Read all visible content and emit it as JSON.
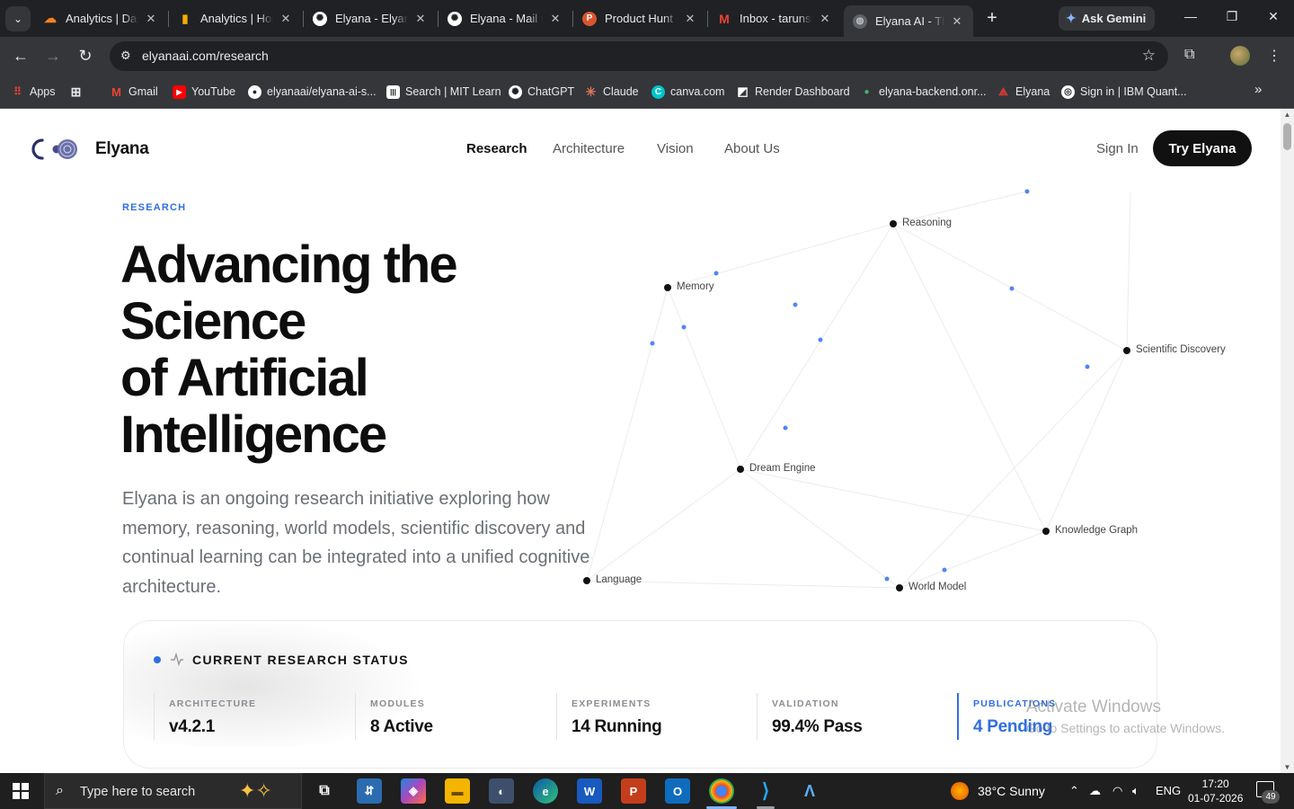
{
  "browser": {
    "tabs": [
      {
        "label": "Analytics | Dashboard",
        "fav_color": "#f6821f",
        "fav_glyph": "☁"
      },
      {
        "label": "Analytics | Home",
        "fav_color": "#f9ab00",
        "fav_glyph": "▮"
      },
      {
        "label": "Elyana - Elyana",
        "fav_color": "#ffffff",
        "fav_glyph": "✺"
      },
      {
        "label": "Elyana - Mail to",
        "fav_color": "#ffffff",
        "fav_glyph": "✺"
      },
      {
        "label": "Product Hunt –",
        "fav_color": "#da552f",
        "fav_glyph": "P"
      },
      {
        "label": "Inbox - tarunsi",
        "fav_color": "#ea4335",
        "fav_glyph": "M"
      },
      {
        "label": "Elyana AI - The",
        "fav_color": "#9aa0a6",
        "fav_glyph": "◍"
      }
    ],
    "new_tab": "+",
    "gemini_label": "Ask Gemini",
    "url": "elyanaai.com/research",
    "bookmarks": [
      {
        "label": "Apps",
        "color": "#4285f4",
        "glyph": "⋮⋮"
      },
      {
        "label": "",
        "color": "#5f6368",
        "glyph": "⊞"
      },
      {
        "label": "Gmail",
        "color": "#ea4335",
        "glyph": "M"
      },
      {
        "label": "YouTube",
        "color": "#ff0000",
        "glyph": "▶"
      },
      {
        "label": "elyanaai/elyana-ai-s...",
        "color": "#ffffff",
        "glyph": "●"
      },
      {
        "label": "Search | MIT Learn",
        "color": "#000000",
        "glyph": "|||"
      },
      {
        "label": "ChatGPT",
        "color": "#ffffff",
        "glyph": "✺"
      },
      {
        "label": "Claude",
        "color": "#d97757",
        "glyph": "✳"
      },
      {
        "label": "canva.com",
        "color": "#00c4cc",
        "glyph": "C"
      },
      {
        "label": "Render Dashboard",
        "color": "#ffffff",
        "glyph": "◩"
      },
      {
        "label": "elyana-backend.onr...",
        "color": "#46b76f",
        "glyph": "●"
      },
      {
        "label": "Elyana",
        "color": "#e53935",
        "glyph": "⟁"
      },
      {
        "label": "Sign in | IBM Quant...",
        "color": "#ffffff",
        "glyph": "◎"
      }
    ]
  },
  "site": {
    "brand": "Elyana",
    "nav": [
      "Research",
      "Architecture",
      "Vision",
      "About Us"
    ],
    "signin": "Sign In",
    "cta": "Try Elyana"
  },
  "hero": {
    "eyebrow": "RESEARCH",
    "title_lines": [
      "Advancing the",
      "Science",
      "of Artificial",
      "Intelligence"
    ],
    "description": "Elyana is an ongoing research initiative exploring how memory, reasoning, world models, scientific discovery and continual learning can be integrated into a unified cognitive architecture."
  },
  "graph": {
    "nodes": [
      "Reasoning",
      "Memory",
      "Scientific Discovery",
      "Dream Engine",
      "Knowledge Graph",
      "Language",
      "World Model"
    ]
  },
  "status": {
    "title": "CURRENT RESEARCH STATUS",
    "metrics": [
      {
        "label": "ARCHITECTURE",
        "value": "v4.2.1"
      },
      {
        "label": "MODULES",
        "value": "8 Active"
      },
      {
        "label": "EXPERIMENTS",
        "value": "14 Running"
      },
      {
        "label": "VALIDATION",
        "value": "99.4% Pass"
      },
      {
        "label": "PUBLICATIONS",
        "value": "4 Pending"
      }
    ],
    "accent_color": "#2f6fe0"
  },
  "watermark": {
    "line1": "Activate Windows",
    "line2": "Go to Settings to activate Windows."
  },
  "taskbar": {
    "search_placeholder": "Type here to search",
    "weather": "38°C  Sunny",
    "language": "ENG",
    "time": "17:20",
    "date": "01-07-2026",
    "notifications": "49"
  }
}
